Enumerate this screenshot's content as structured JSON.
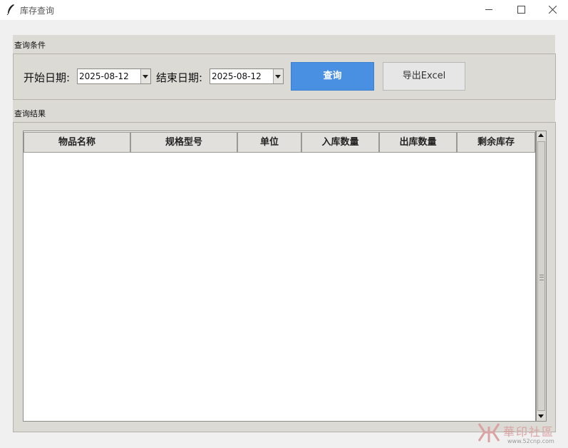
{
  "window": {
    "title": "库存查询",
    "icon": "feather-icon"
  },
  "query_section": {
    "label": "查询条件",
    "start_label": "开始日期:",
    "start_value": "2025-08-12",
    "end_label": "结束日期:",
    "end_value": "2025-08-12",
    "query_button": "查询",
    "export_button": "导出Excel"
  },
  "result_section": {
    "label": "查询结果",
    "columns": [
      "物品名称",
      "规格型号",
      "单位",
      "入库数量",
      "出库数量",
      "剩余库存"
    ],
    "rows": []
  },
  "watermark": {
    "text": "華印社區",
    "url": "www.52cnp.com"
  },
  "colors": {
    "query_button": "#4a90e2",
    "frame_bg": "#dcdad5"
  }
}
